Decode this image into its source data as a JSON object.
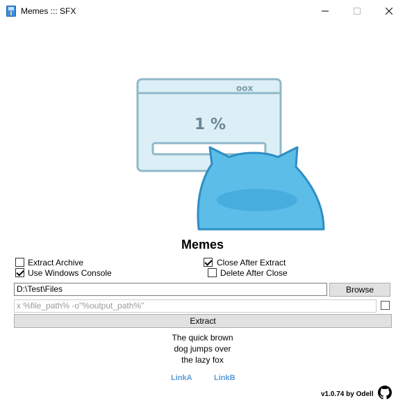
{
  "window": {
    "title": "Memes ::: SFX",
    "icon": "archive-app-icon",
    "controls": [
      "minimize-icon",
      "maximize-icon",
      "close-icon"
    ]
  },
  "illustration": {
    "icon": "cat-peeking-progress-window-image",
    "window_caption": "oox",
    "progress_text": "1 %"
  },
  "heading": "Memes",
  "options": {
    "extract_archive": {
      "label": "Extract Archive",
      "checked": false
    },
    "use_windows_console": {
      "label": "Use Windows Console",
      "checked": true
    },
    "close_after_extract": {
      "label": "Close After Extract",
      "checked": true
    },
    "delete_after_close": {
      "label": "Delete After Close",
      "checked": false
    }
  },
  "path": {
    "value": "D:\\Test\\Files",
    "browse_label": "Browse"
  },
  "command": {
    "placeholder": "x %file_path% -o\"%output_path%\"",
    "enabled": false
  },
  "extract_label": "Extract",
  "blurb": {
    "line1": "The quick brown",
    "line2": "dog jumps over",
    "line3": "the lazy fox"
  },
  "links": {
    "a": "LinkA",
    "b": "LinkB"
  },
  "footer": {
    "version": "v1.0.74 by Odell",
    "icon": "github-icon"
  },
  "colors": {
    "link": "#5b9bd5",
    "button": "#e1e1e1",
    "cat": "#5bbde8",
    "window_art": "#dceff7"
  }
}
